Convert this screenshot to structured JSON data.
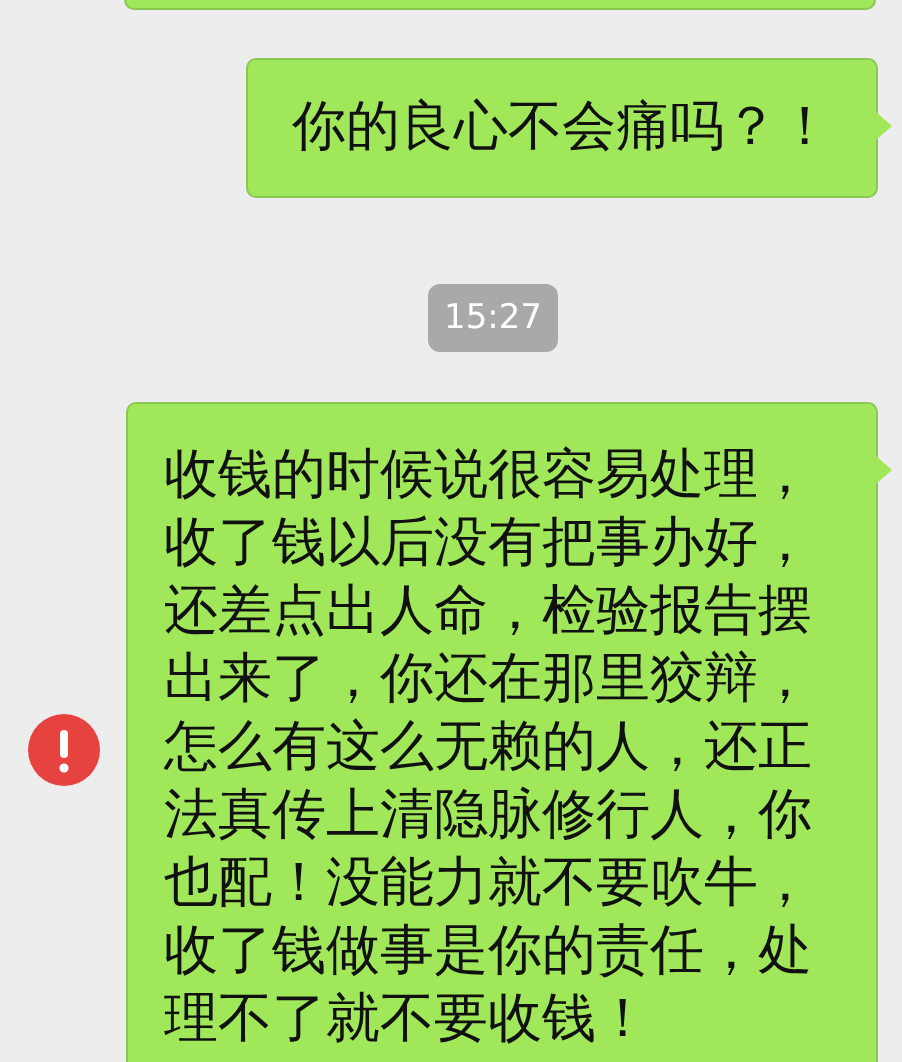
{
  "messages": [
    {
      "kind": "partial"
    },
    {
      "kind": "text",
      "text": "你的良心不会痛吗？！",
      "failed": false
    },
    {
      "kind": "time",
      "text": "15:27"
    },
    {
      "kind": "text",
      "text": "收钱的时候说很容易处理，收了钱以后没有把事办好，还差点出人命，检验报告摆出来了，你还在那里狡辩，怎么有这么无赖的人，还正法真传上清隐脉修行人，你也配！没能力就不要吹牛，收了钱做事是你的责任，处理不了就不要收钱！",
      "failed": true
    }
  ]
}
